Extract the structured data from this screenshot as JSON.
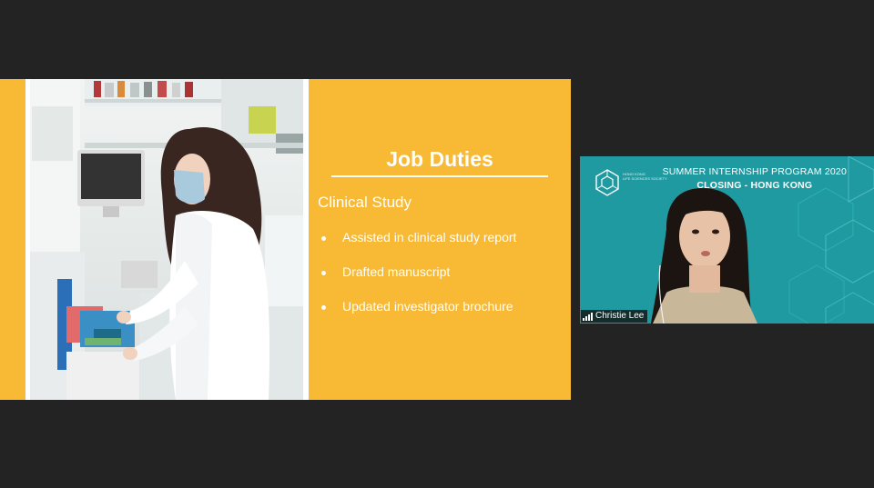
{
  "slide": {
    "title": "Job Duties",
    "section": "Clinical Study",
    "duties": [
      "Assisted in clinical study report",
      "Drafted manuscript",
      "Updated investigator brochure"
    ]
  },
  "video": {
    "participant_name": "Christie Lee",
    "background_title_line1": "SUMMER INTERNSHIP PROGRAM 2020",
    "background_title_line2": "CLOSING - HONG KONG",
    "society_label": "HONG KONG\nLIFE SCIENCES SOCIETY",
    "signal_icon": "signal-bars-icon"
  },
  "colors": {
    "background": "#232323",
    "slide_accent": "#f8b934",
    "video_background": "#1e9aa0"
  }
}
